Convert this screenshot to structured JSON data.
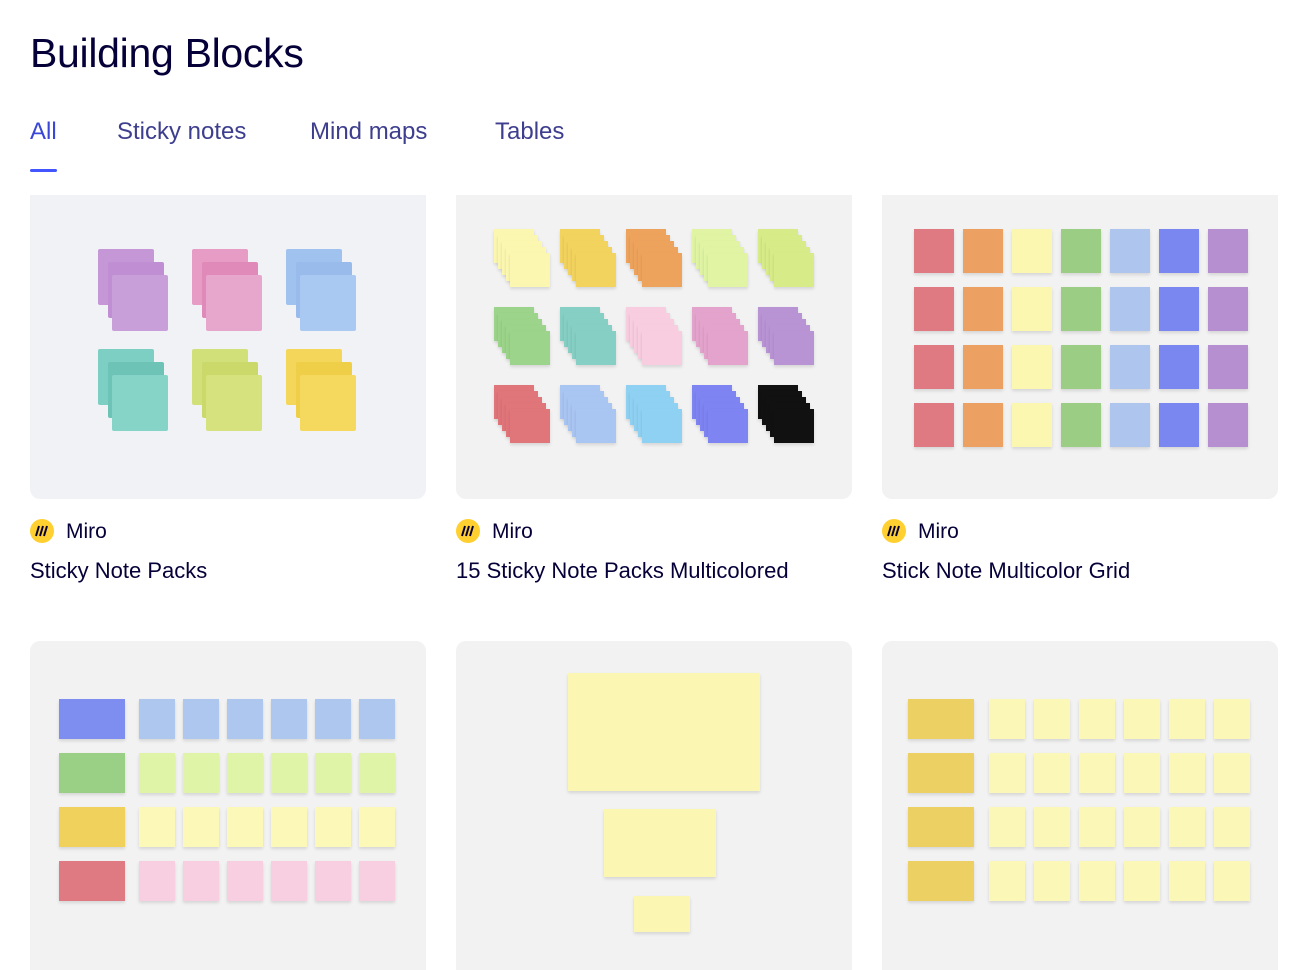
{
  "page": {
    "title": "Building Blocks"
  },
  "tabs": [
    {
      "label": "All",
      "active": true
    },
    {
      "label": "Sticky notes",
      "active": false
    },
    {
      "label": "Mind maps",
      "active": false
    },
    {
      "label": "Tables",
      "active": false
    }
  ],
  "colors": {
    "accent": "#4255ff",
    "tab_text": "#3e3e8e",
    "title_text": "#050038",
    "miro_yellow": "#ffd02f"
  },
  "cards": [
    {
      "author": "Miro",
      "title": "Sticky Note Packs",
      "author_icon": "miro-logo-icon"
    },
    {
      "author": "Miro",
      "title": "15 Sticky Note Packs Multicolored",
      "author_icon": "miro-logo-icon"
    },
    {
      "author": "Miro",
      "title": "Stick Note Multicolor Grid",
      "author_icon": "miro-logo-icon"
    },
    {
      "author": "",
      "title": ""
    },
    {
      "author": "",
      "title": ""
    },
    {
      "author": "",
      "title": ""
    }
  ]
}
